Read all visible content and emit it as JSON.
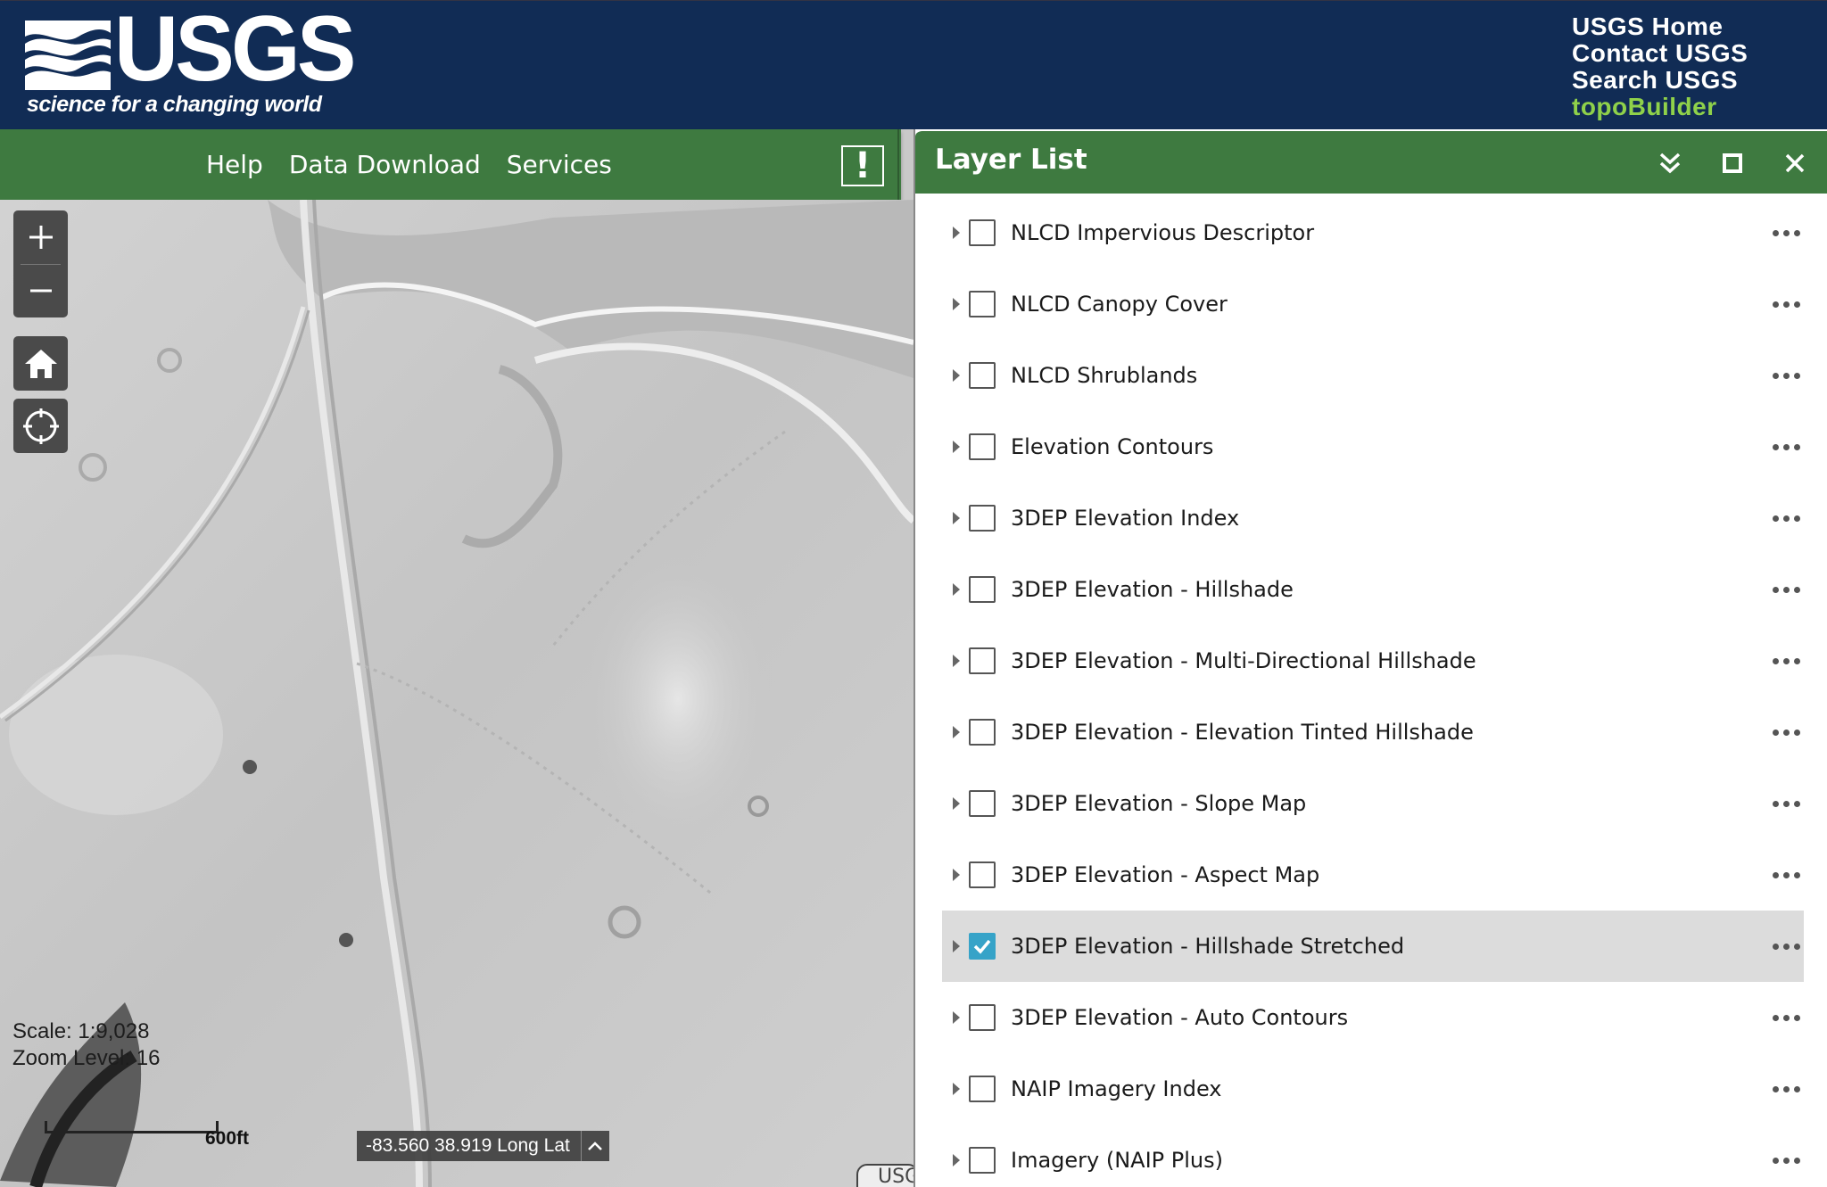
{
  "header": {
    "logo_text": "USGS",
    "tagline": "science for a changing world",
    "links": [
      "USGS Home",
      "Contact USGS",
      "Search USGS",
      "topoBuilder"
    ]
  },
  "nav": {
    "items": [
      "Help",
      "Data Download",
      "Services"
    ],
    "alert_label": "!"
  },
  "map": {
    "zoom_in": "+",
    "zoom_out": "−",
    "scale_text": "Scale: 1:9,028",
    "zoom_level_text": "Zoom Level: 16",
    "scalebar_label": "600ft",
    "coords_text": "-83.560 38.919 Long Lat",
    "corner_tag": "USG",
    "icons": [
      "plus-icon",
      "minus-icon",
      "home-icon",
      "locate-icon",
      "chevron-up-icon"
    ]
  },
  "layer_list": {
    "title": "Layer List",
    "controls": [
      "collapse-icon",
      "maximize-icon",
      "close-icon"
    ],
    "layers": [
      {
        "label": "NLCD Impervious Descriptor",
        "checked": false
      },
      {
        "label": "NLCD Canopy Cover",
        "checked": false
      },
      {
        "label": "NLCD Shrublands",
        "checked": false
      },
      {
        "label": "Elevation Contours",
        "checked": false
      },
      {
        "label": "3DEP Elevation Index",
        "checked": false
      },
      {
        "label": "3DEP Elevation - Hillshade",
        "checked": false
      },
      {
        "label": "3DEP Elevation - Multi-Directional Hillshade",
        "checked": false
      },
      {
        "label": "3DEP Elevation - Elevation Tinted Hillshade",
        "checked": false
      },
      {
        "label": "3DEP Elevation - Slope Map",
        "checked": false
      },
      {
        "label": "3DEP Elevation - Aspect Map",
        "checked": false
      },
      {
        "label": "3DEP Elevation - Hillshade Stretched",
        "checked": true
      },
      {
        "label": "3DEP Elevation - Auto Contours",
        "checked": false
      },
      {
        "label": "NAIP Imagery Index",
        "checked": false
      },
      {
        "label": "Imagery (NAIP Plus)",
        "checked": false
      }
    ]
  },
  "colors": {
    "header_bg": "#112c55",
    "nav_green": "#3e7a40",
    "accent_green": "#8fd14a",
    "checkbox_checked": "#36a3c8"
  }
}
